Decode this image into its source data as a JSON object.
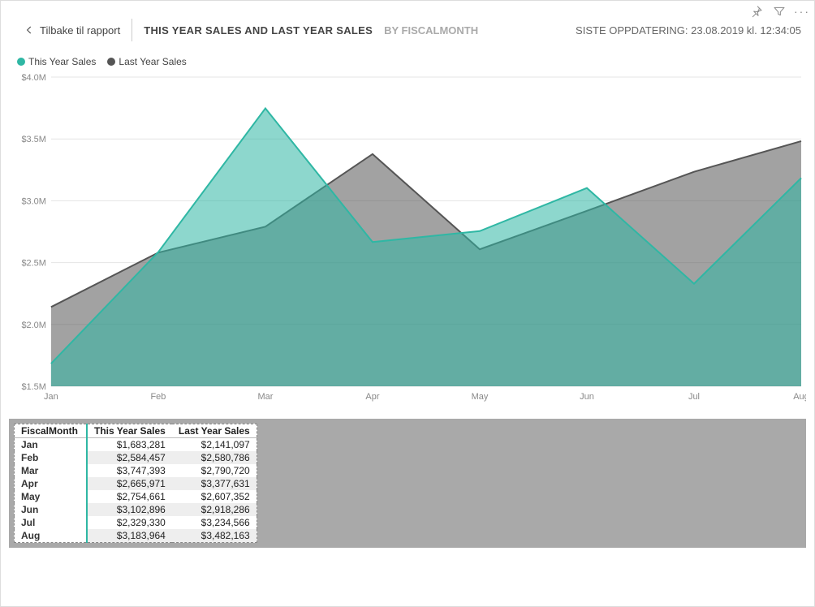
{
  "toolbar": {
    "pin_icon": "pin-icon",
    "filter_icon": "filter-icon",
    "more_icon": "more-icon"
  },
  "header": {
    "back_label": "Tilbake til rapport",
    "title_main": "THIS YEAR SALES AND LAST YEAR SALES",
    "title_sub": "BY FISCALMONTH",
    "updated": "SISTE OPPDATERING: 23.08.2019 kl. 12:34:05"
  },
  "legend": [
    {
      "label": "This Year Sales",
      "color": "#2fb7a4"
    },
    {
      "label": "Last Year Sales",
      "color": "#555555"
    }
  ],
  "axes": {
    "y_ticks": [
      "$4.0M",
      "$3.5M",
      "$3.0M",
      "$2.5M",
      "$2.0M",
      "$1.5M"
    ],
    "x_ticks": [
      "Jan",
      "Feb",
      "Mar",
      "Apr",
      "May",
      "Jun",
      "Jul",
      "Aug"
    ]
  },
  "table": {
    "headers": [
      "FiscalMonth",
      "This Year Sales",
      "Last Year Sales"
    ],
    "rows": [
      {
        "month": "Jan",
        "this_year": "$1,683,281",
        "last_year": "$2,141,097"
      },
      {
        "month": "Feb",
        "this_year": "$2,584,457",
        "last_year": "$2,580,786"
      },
      {
        "month": "Mar",
        "this_year": "$3,747,393",
        "last_year": "$2,790,720"
      },
      {
        "month": "Apr",
        "this_year": "$2,665,971",
        "last_year": "$3,377,631"
      },
      {
        "month": "May",
        "this_year": "$2,754,661",
        "last_year": "$2,607,352"
      },
      {
        "month": "Jun",
        "this_year": "$3,102,896",
        "last_year": "$2,918,286"
      },
      {
        "month": "Jul",
        "this_year": "$2,329,330",
        "last_year": "$3,234,566"
      },
      {
        "month": "Aug",
        "this_year": "$3,183,964",
        "last_year": "$3,482,163"
      }
    ]
  },
  "chart_data": {
    "type": "area",
    "title": "THIS YEAR SALES AND LAST YEAR SALES",
    "xlabel": "",
    "ylabel": "",
    "ylim": [
      1500000,
      4000000
    ],
    "categories": [
      "Jan",
      "Feb",
      "Mar",
      "Apr",
      "May",
      "Jun",
      "Jul",
      "Aug"
    ],
    "series": [
      {
        "name": "This Year Sales",
        "color": "#2fb7a4",
        "values": [
          1683281,
          2584457,
          3747393,
          2665971,
          2754661,
          3102896,
          2329330,
          3183964
        ]
      },
      {
        "name": "Last Year Sales",
        "color": "#555555",
        "values": [
          2141097,
          2580786,
          2790720,
          3377631,
          2607352,
          2918286,
          3234566,
          3482163
        ]
      }
    ]
  }
}
